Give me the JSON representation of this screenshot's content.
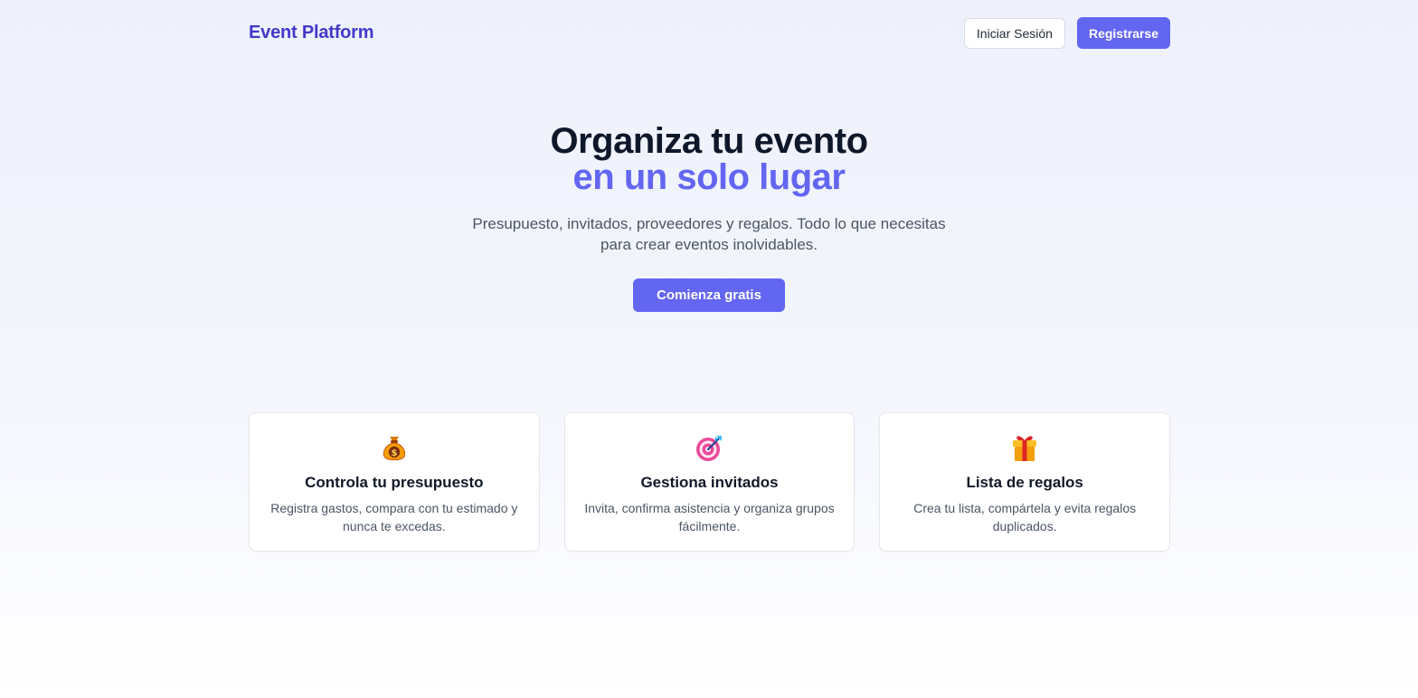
{
  "header": {
    "brand": "Event Platform",
    "login_label": "Iniciar Sesión",
    "register_label": "Registrarse"
  },
  "hero": {
    "title_line1": "Organiza tu evento",
    "title_line2": "en un solo lugar",
    "subtitle": "Presupuesto, invitados, proveedores y regalos. Todo lo que necesitas para crear eventos inolvidables.",
    "cta_label": "Comienza gratis"
  },
  "features": [
    {
      "icon": "money-bag-icon",
      "title": "Controla tu presupuesto",
      "description": "Registra gastos, compara con tu estimado y nunca te excedas."
    },
    {
      "icon": "target-icon",
      "title": "Gestiona invitados",
      "description": "Invita, confirma asistencia y organiza grupos fácilmente."
    },
    {
      "icon": "gift-icon",
      "title": "Lista de regalos",
      "description": "Crea tu lista, compártela y evita regalos duplicados."
    }
  ],
  "colors": {
    "accent": "#6366f1",
    "brand": "#4338ca",
    "heading": "#0f172a",
    "body_text": "#4b5563"
  }
}
